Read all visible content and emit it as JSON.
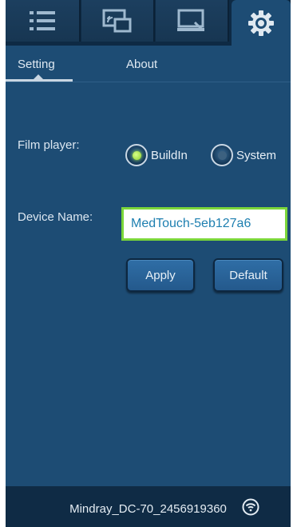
{
  "top_tabs": [
    {
      "name": "list",
      "icon": "list-icon"
    },
    {
      "name": "cast",
      "icon": "cast-screen-icon"
    },
    {
      "name": "display",
      "icon": "monitor-icon"
    },
    {
      "name": "settings",
      "icon": "gear-icon",
      "active": true
    }
  ],
  "sub_tabs": {
    "setting": "Setting",
    "about": "About"
  },
  "film_player": {
    "label": "Film player:",
    "options": [
      "BuildIn",
      "System"
    ],
    "selected": "BuildIn"
  },
  "device_name": {
    "label": "Device Name:",
    "value": "MedTouch-5eb127a6"
  },
  "buttons": {
    "apply": "Apply",
    "default": "Default"
  },
  "footer": {
    "device_id": "Mindray_DC-70_2456919360",
    "status_icon": "wifi-icon"
  },
  "colors": {
    "background": "#1d4c74",
    "bar": "#0e2a44",
    "input_border": "#7bd63a",
    "input_text": "#1e7fb0"
  }
}
